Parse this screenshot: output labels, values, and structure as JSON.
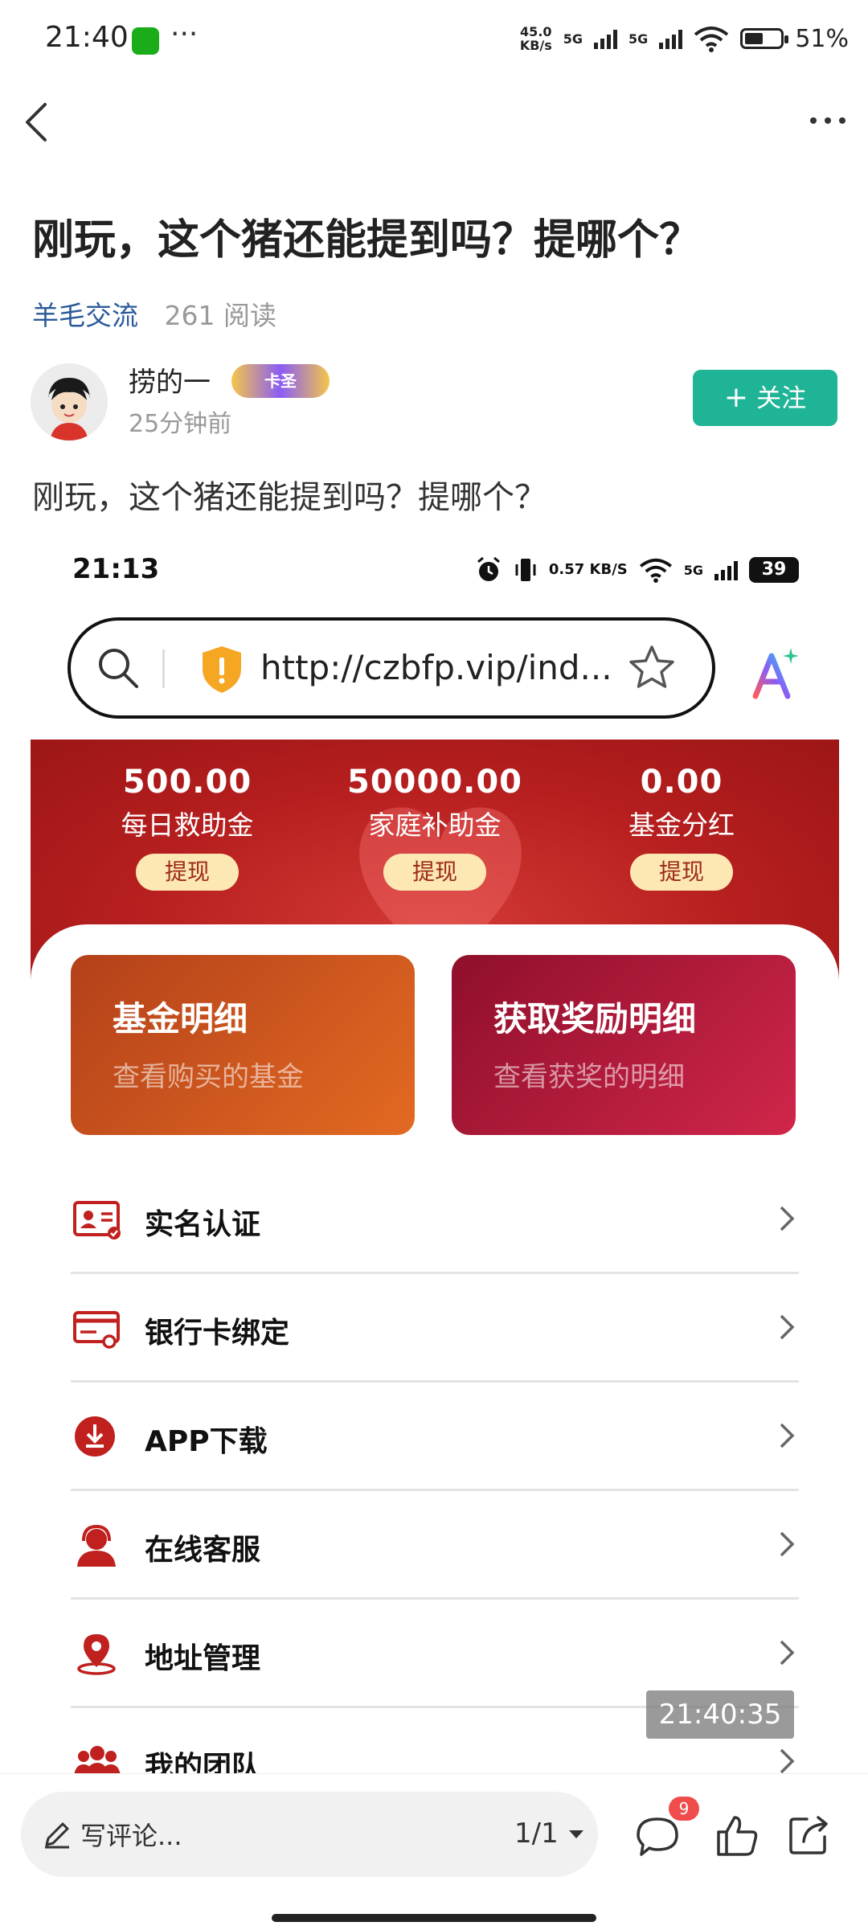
{
  "status_bar": {
    "time": "21:40",
    "dots": "···",
    "speed": "45.0\nKB/s",
    "net1": "5G",
    "net2": "5G",
    "battery": "51%"
  },
  "post": {
    "title": "刚玩，这个猪还能提到吗？提哪个？",
    "category": "羊毛交流",
    "reads": "261 阅读",
    "author": "捞的一",
    "badge": "卡圣",
    "time_ago": "25分钟前",
    "follow_label": "关注",
    "body": "刚玩，这个猪还能提到吗？提哪个？"
  },
  "screenshot": {
    "time": "21:13",
    "speed": "0.57 KB/S",
    "net": "5G",
    "battery": "39",
    "url": "http://czbfp.vip/ind...",
    "stats": [
      {
        "value": "500.00",
        "label": "每日救助金",
        "button": "提现"
      },
      {
        "value": "50000.00",
        "label": "家庭补助金",
        "button": "提现"
      },
      {
        "value": "0.00",
        "label": "基金分红",
        "button": "提现"
      }
    ],
    "cards": [
      {
        "title": "基金明细",
        "subtitle": "查看购买的基金"
      },
      {
        "title": "获取奖励明细",
        "subtitle": "查看获奖的明细"
      }
    ],
    "menu": [
      {
        "label": "实名认证",
        "icon": "id-card-icon"
      },
      {
        "label": "银行卡绑定",
        "icon": "bank-card-icon"
      },
      {
        "label": "APP下载",
        "icon": "download-icon"
      },
      {
        "label": "在线客服",
        "icon": "support-icon"
      },
      {
        "label": "地址管理",
        "icon": "location-icon"
      },
      {
        "label": "我的团队",
        "icon": "team-icon"
      }
    ],
    "accent": "#c0201e",
    "timestamp": "21:40:35"
  },
  "bottom_bar": {
    "comment_placeholder": "写评论...",
    "pager": "1/1",
    "comment_count": "9"
  }
}
